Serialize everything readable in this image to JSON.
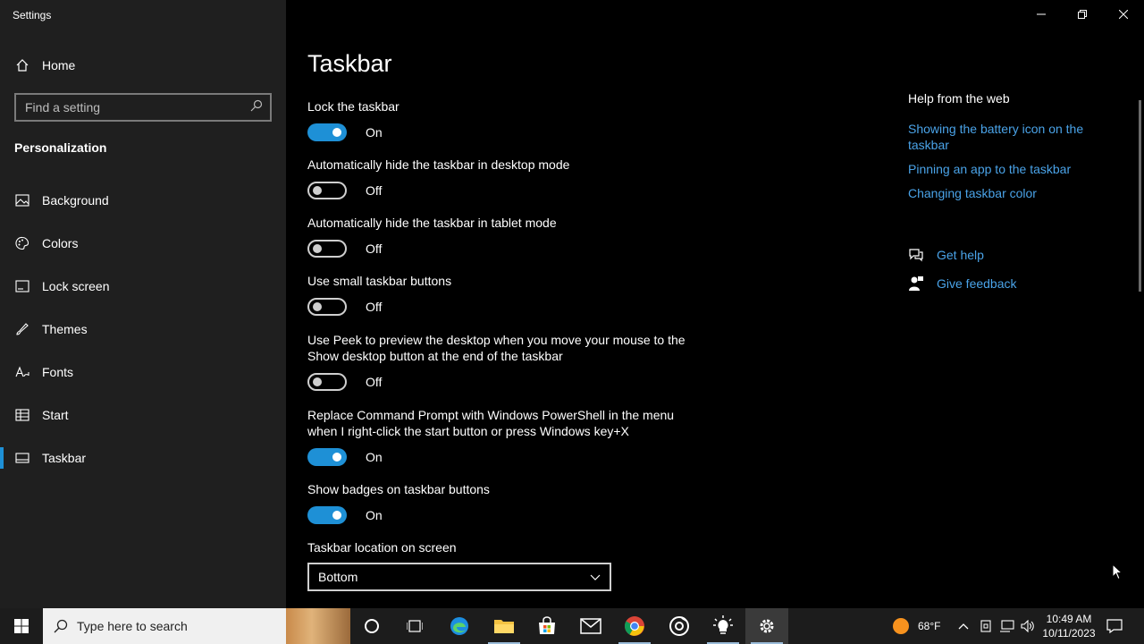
{
  "window": {
    "title": "Settings",
    "controls": [
      "minimize",
      "restore",
      "close"
    ]
  },
  "sidebar": {
    "home_label": "Home",
    "search_placeholder": "Find a setting",
    "section": "Personalization",
    "items": [
      {
        "label": "Background",
        "icon": "image-icon"
      },
      {
        "label": "Colors",
        "icon": "palette-icon"
      },
      {
        "label": "Lock screen",
        "icon": "lock-screen-icon"
      },
      {
        "label": "Themes",
        "icon": "brush-icon"
      },
      {
        "label": "Fonts",
        "icon": "font-icon"
      },
      {
        "label": "Start",
        "icon": "start-icon"
      },
      {
        "label": "Taskbar",
        "icon": "taskbar-icon",
        "selected": true
      }
    ]
  },
  "main": {
    "title": "Taskbar",
    "settings": [
      {
        "label": "Lock the taskbar",
        "state": "On",
        "on": true
      },
      {
        "label": "Automatically hide the taskbar in desktop mode",
        "state": "Off",
        "on": false
      },
      {
        "label": "Automatically hide the taskbar in tablet mode",
        "state": "Off",
        "on": false
      },
      {
        "label": "Use small taskbar buttons",
        "state": "Off",
        "on": false
      },
      {
        "label": "Use Peek to preview the desktop when you move your mouse to the Show desktop button at the end of the taskbar",
        "state": "Off",
        "on": false
      },
      {
        "label": "Replace Command Prompt with Windows PowerShell in the menu when I right-click the start button or press Windows key+X",
        "state": "On",
        "on": true
      },
      {
        "label": "Show badges on taskbar buttons",
        "state": "On",
        "on": true
      }
    ],
    "location": {
      "label": "Taskbar location on screen",
      "value": "Bottom"
    }
  },
  "help": {
    "heading": "Help from the web",
    "links": [
      "Showing the battery icon on the taskbar",
      "Pinning an app to the taskbar",
      "Changing taskbar color"
    ],
    "get_help": "Get help",
    "give_feedback": "Give feedback"
  },
  "taskbar": {
    "search_placeholder": "Type here to search",
    "apps": [
      "cortana-icon",
      "task-view-icon",
      "edge-icon",
      "file-explorer-icon",
      "store-icon",
      "mail-icon",
      "chrome-icon",
      "media-icon",
      "tips-icon",
      "settings-icon"
    ],
    "weather": "68°F",
    "time": "10:49 AM",
    "date": "10/11/2023"
  },
  "colors": {
    "accent": "#1e90d6",
    "link": "#4aa3e8",
    "sidebar": "#1f1f1f",
    "background": "#000000"
  }
}
